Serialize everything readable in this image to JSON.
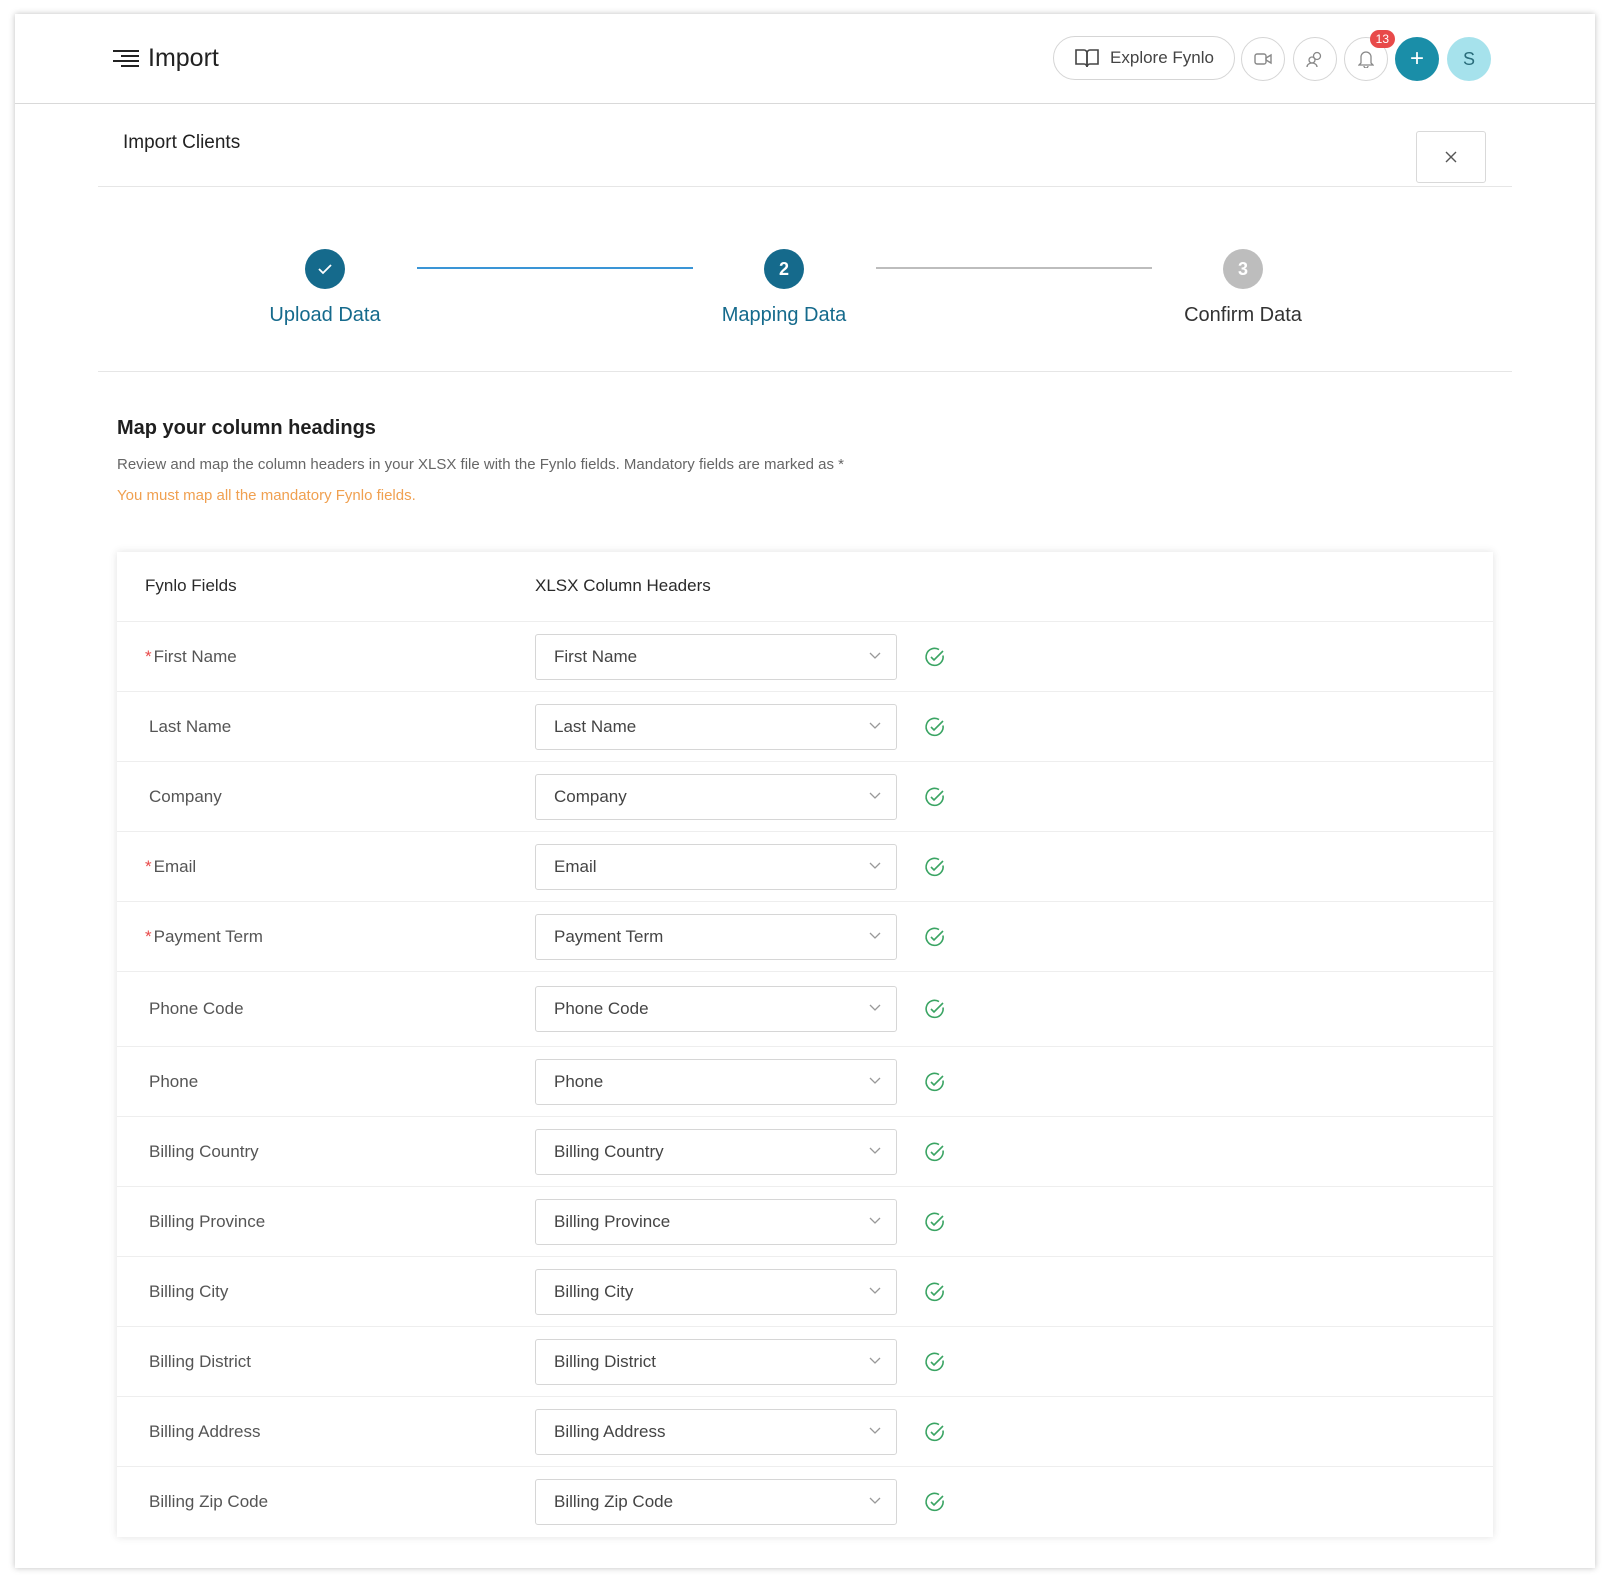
{
  "header": {
    "title": "Import",
    "explore_label": "Explore Fynlo",
    "notification_count": "13",
    "avatar_initial": "S",
    "plus_label": "+"
  },
  "subheader": {
    "title": "Import Clients",
    "close_label": "×"
  },
  "stepper": {
    "steps": [
      {
        "label": "Upload Data",
        "status": "completed"
      },
      {
        "label": "Mapping Data",
        "number": "2",
        "status": "active"
      },
      {
        "label": "Confirm Data",
        "number": "3",
        "status": "pending"
      }
    ]
  },
  "section": {
    "title": "Map your column headings",
    "description": "Review and map the column headers in your XLSX file with the Fynlo fields. Mandatory fields are marked as *",
    "warning": "You must map all the mandatory Fynlo fields."
  },
  "table": {
    "col1": "Fynlo Fields",
    "col2": "XLSX Column Headers",
    "rows": [
      {
        "field": "First Name",
        "required": true,
        "mapped": "First Name"
      },
      {
        "field": "Last  Name",
        "required": false,
        "mapped": "Last  Name"
      },
      {
        "field": "Company",
        "required": false,
        "mapped": "Company"
      },
      {
        "field": "Email",
        "required": true,
        "mapped": "Email"
      },
      {
        "field": "Payment Term",
        "required": true,
        "mapped": "Payment Term"
      },
      {
        "field": "Phone Code",
        "required": false,
        "mapped": "Phone Code"
      },
      {
        "field": "Phone",
        "required": false,
        "mapped": "Phone"
      },
      {
        "field": "Billing Country",
        "required": false,
        "mapped": "Billing Country"
      },
      {
        "field": "Billing Province",
        "required": false,
        "mapped": "Billing Province"
      },
      {
        "field": "Billing City",
        "required": false,
        "mapped": "Billing City"
      },
      {
        "field": "Billing District",
        "required": false,
        "mapped": "Billing District"
      },
      {
        "field": "Billing Address",
        "required": false,
        "mapped": "Billing Address"
      },
      {
        "field": "Billing Zip Code",
        "required": false,
        "mapped": "Billing Zip Code"
      }
    ]
  },
  "colors": {
    "primary": "#156a8c",
    "active_line": "#3a95d6",
    "pending": "#bdbdbd",
    "success": "#3aa463",
    "warning": "#f0a050",
    "required": "#e84a4a"
  }
}
